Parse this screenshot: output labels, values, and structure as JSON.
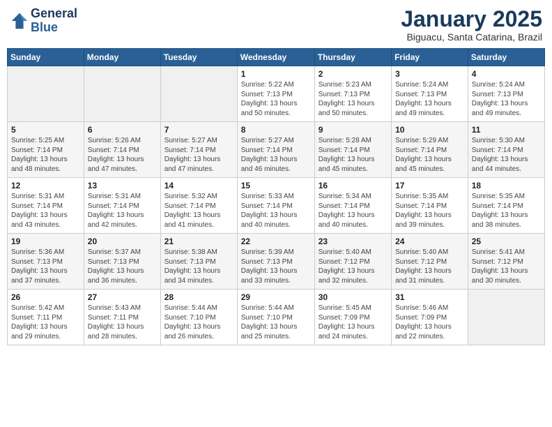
{
  "header": {
    "logo_text_general": "General",
    "logo_text_blue": "Blue",
    "month_title": "January 2025",
    "location": "Biguacu, Santa Catarina, Brazil"
  },
  "weekdays": [
    "Sunday",
    "Monday",
    "Tuesday",
    "Wednesday",
    "Thursday",
    "Friday",
    "Saturday"
  ],
  "weeks": [
    [
      {
        "day": "",
        "info": ""
      },
      {
        "day": "",
        "info": ""
      },
      {
        "day": "",
        "info": ""
      },
      {
        "day": "1",
        "info": "Sunrise: 5:22 AM\nSunset: 7:13 PM\nDaylight: 13 hours\nand 50 minutes."
      },
      {
        "day": "2",
        "info": "Sunrise: 5:23 AM\nSunset: 7:13 PM\nDaylight: 13 hours\nand 50 minutes."
      },
      {
        "day": "3",
        "info": "Sunrise: 5:24 AM\nSunset: 7:13 PM\nDaylight: 13 hours\nand 49 minutes."
      },
      {
        "day": "4",
        "info": "Sunrise: 5:24 AM\nSunset: 7:13 PM\nDaylight: 13 hours\nand 49 minutes."
      }
    ],
    [
      {
        "day": "5",
        "info": "Sunrise: 5:25 AM\nSunset: 7:14 PM\nDaylight: 13 hours\nand 48 minutes."
      },
      {
        "day": "6",
        "info": "Sunrise: 5:26 AM\nSunset: 7:14 PM\nDaylight: 13 hours\nand 47 minutes."
      },
      {
        "day": "7",
        "info": "Sunrise: 5:27 AM\nSunset: 7:14 PM\nDaylight: 13 hours\nand 47 minutes."
      },
      {
        "day": "8",
        "info": "Sunrise: 5:27 AM\nSunset: 7:14 PM\nDaylight: 13 hours\nand 46 minutes."
      },
      {
        "day": "9",
        "info": "Sunrise: 5:28 AM\nSunset: 7:14 PM\nDaylight: 13 hours\nand 45 minutes."
      },
      {
        "day": "10",
        "info": "Sunrise: 5:29 AM\nSunset: 7:14 PM\nDaylight: 13 hours\nand 45 minutes."
      },
      {
        "day": "11",
        "info": "Sunrise: 5:30 AM\nSunset: 7:14 PM\nDaylight: 13 hours\nand 44 minutes."
      }
    ],
    [
      {
        "day": "12",
        "info": "Sunrise: 5:31 AM\nSunset: 7:14 PM\nDaylight: 13 hours\nand 43 minutes."
      },
      {
        "day": "13",
        "info": "Sunrise: 5:31 AM\nSunset: 7:14 PM\nDaylight: 13 hours\nand 42 minutes."
      },
      {
        "day": "14",
        "info": "Sunrise: 5:32 AM\nSunset: 7:14 PM\nDaylight: 13 hours\nand 41 minutes."
      },
      {
        "day": "15",
        "info": "Sunrise: 5:33 AM\nSunset: 7:14 PM\nDaylight: 13 hours\nand 40 minutes."
      },
      {
        "day": "16",
        "info": "Sunrise: 5:34 AM\nSunset: 7:14 PM\nDaylight: 13 hours\nand 40 minutes."
      },
      {
        "day": "17",
        "info": "Sunrise: 5:35 AM\nSunset: 7:14 PM\nDaylight: 13 hours\nand 39 minutes."
      },
      {
        "day": "18",
        "info": "Sunrise: 5:35 AM\nSunset: 7:14 PM\nDaylight: 13 hours\nand 38 minutes."
      }
    ],
    [
      {
        "day": "19",
        "info": "Sunrise: 5:36 AM\nSunset: 7:13 PM\nDaylight: 13 hours\nand 37 minutes."
      },
      {
        "day": "20",
        "info": "Sunrise: 5:37 AM\nSunset: 7:13 PM\nDaylight: 13 hours\nand 36 minutes."
      },
      {
        "day": "21",
        "info": "Sunrise: 5:38 AM\nSunset: 7:13 PM\nDaylight: 13 hours\nand 34 minutes."
      },
      {
        "day": "22",
        "info": "Sunrise: 5:39 AM\nSunset: 7:13 PM\nDaylight: 13 hours\nand 33 minutes."
      },
      {
        "day": "23",
        "info": "Sunrise: 5:40 AM\nSunset: 7:12 PM\nDaylight: 13 hours\nand 32 minutes."
      },
      {
        "day": "24",
        "info": "Sunrise: 5:40 AM\nSunset: 7:12 PM\nDaylight: 13 hours\nand 31 minutes."
      },
      {
        "day": "25",
        "info": "Sunrise: 5:41 AM\nSunset: 7:12 PM\nDaylight: 13 hours\nand 30 minutes."
      }
    ],
    [
      {
        "day": "26",
        "info": "Sunrise: 5:42 AM\nSunset: 7:11 PM\nDaylight: 13 hours\nand 29 minutes."
      },
      {
        "day": "27",
        "info": "Sunrise: 5:43 AM\nSunset: 7:11 PM\nDaylight: 13 hours\nand 28 minutes."
      },
      {
        "day": "28",
        "info": "Sunrise: 5:44 AM\nSunset: 7:10 PM\nDaylight: 13 hours\nand 26 minutes."
      },
      {
        "day": "29",
        "info": "Sunrise: 5:44 AM\nSunset: 7:10 PM\nDaylight: 13 hours\nand 25 minutes."
      },
      {
        "day": "30",
        "info": "Sunrise: 5:45 AM\nSunset: 7:09 PM\nDaylight: 13 hours\nand 24 minutes."
      },
      {
        "day": "31",
        "info": "Sunrise: 5:46 AM\nSunset: 7:09 PM\nDaylight: 13 hours\nand 22 minutes."
      },
      {
        "day": "",
        "info": ""
      }
    ]
  ]
}
